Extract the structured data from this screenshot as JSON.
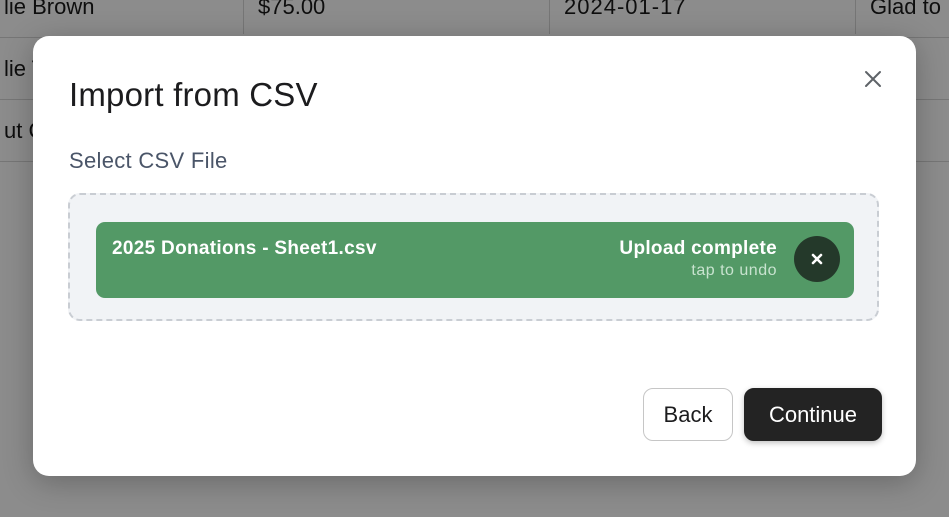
{
  "background_table": {
    "rows": [
      [
        "lie Brown",
        "$75.00",
        "2024-01-17",
        "Glad to"
      ],
      [
        "lie T",
        "",
        "",
        ""
      ],
      [
        "ut C",
        "",
        "",
        ""
      ]
    ]
  },
  "modal": {
    "title": "Import from CSV",
    "close_icon": "close-icon",
    "field_label": "Select CSV File",
    "file": {
      "name": "2025 Donations - Sheet1.csv",
      "status": "Upload complete",
      "status_hint": "tap to undo",
      "undo_icon": "close-icon"
    },
    "buttons": {
      "back": "Back",
      "continue": "Continue"
    }
  },
  "colors": {
    "success": "#539966",
    "success_dark": "#24392a",
    "primary": "#232323",
    "dropzone_bg": "#f1f3f6"
  }
}
